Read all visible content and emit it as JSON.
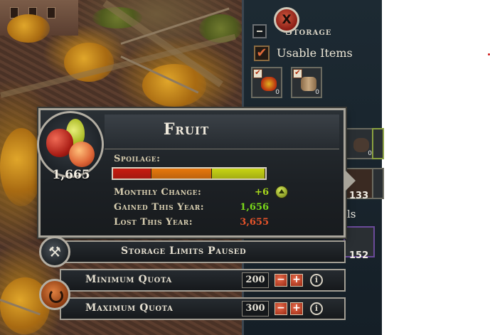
{
  "storage_panel": {
    "title": "Storage",
    "usable_items_label": "Usable Items",
    "usable_items_checked": true,
    "slot_counts": [
      "0",
      "0",
      "0"
    ],
    "partial_texts": {
      "count_a": "133",
      "count_b": "152",
      "fragment": "ls"
    }
  },
  "tooltip": {
    "item_name": "Fruit",
    "quantity": "1,665",
    "close_label": "X",
    "spoilage_label": "Spoilage:",
    "spoilage_segments": [
      {
        "color": "#c81c10",
        "fraction": 0.25
      },
      {
        "color": "#e8780c",
        "fraction": 0.4
      },
      {
        "color": "#c8d414",
        "fraction": 0.35
      }
    ],
    "monthly_change_label": "Monthly Change:",
    "monthly_change_value": "+6",
    "gained_label": "Gained This Year:",
    "gained_value": "1,656",
    "lost_label": "Lost This Year:",
    "lost_value": "3,655",
    "colors": {
      "positive": "#a8d81c",
      "gained": "#7ad81a",
      "lost": "#e8542a"
    }
  },
  "storage_limits": {
    "status_text": "Storage Limits Paused",
    "hammer_icon": "hammer-icon"
  },
  "quotas": {
    "minimum_label": "Minimum Quota",
    "minimum_value": "200",
    "maximum_label": "Maximum Quota",
    "maximum_value": "300",
    "minus": "−",
    "plus": "+",
    "info": "i"
  }
}
